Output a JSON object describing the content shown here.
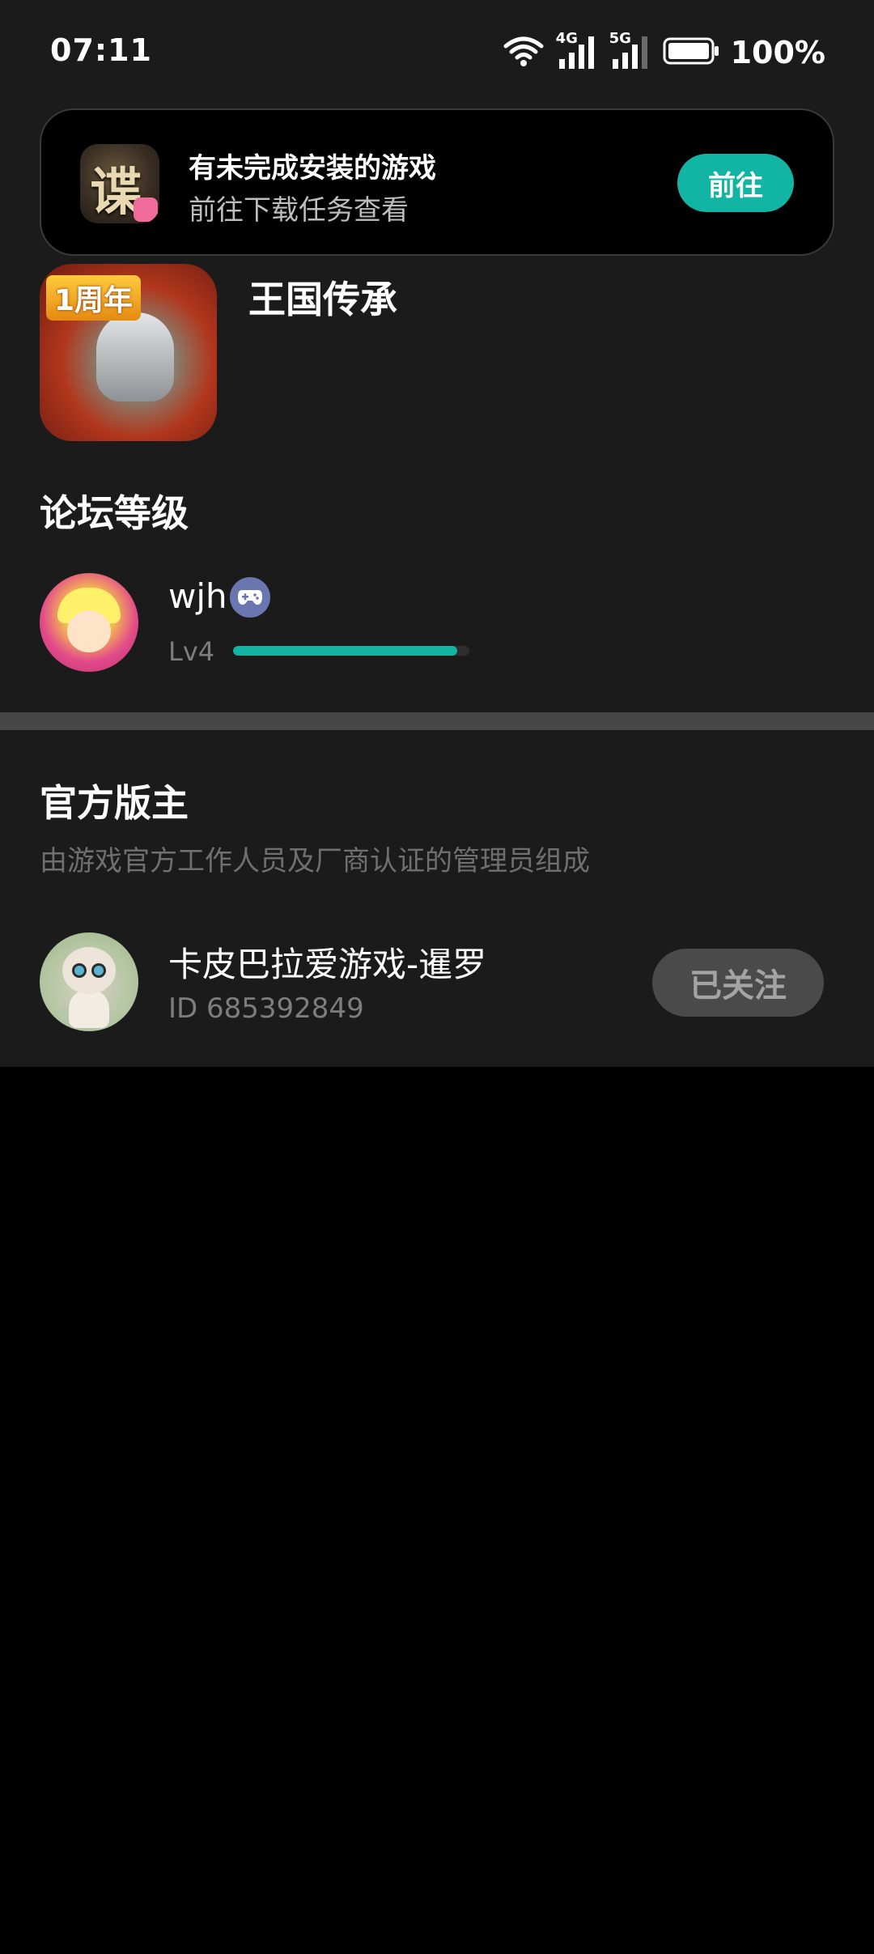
{
  "status_bar": {
    "time": "07:11",
    "network_1": "4G",
    "network_2": "5G",
    "battery_percent": "100%"
  },
  "banner": {
    "title": "有未完成安装的游戏",
    "subtitle": "前往下载任务查看",
    "button_label": "前往",
    "icon_glyph": "谍"
  },
  "game": {
    "title": "王国传承",
    "icon_badge": "1周年"
  },
  "forum_level": {
    "section_title": "论坛等级",
    "username": "wjh",
    "level_label": "Lv4",
    "level_progress": 0.95
  },
  "official_moderators": {
    "section_title": "官方版主",
    "section_desc": "由游戏官方工作人员及厂商认证的管理员组成",
    "moderators": [
      {
        "name": "卡皮巴拉爱游戏-暹罗",
        "id_text": "ID 685392849",
        "follow_label": "已关注"
      }
    ]
  },
  "colors": {
    "accent": "#12b5a4",
    "panel_bg": "#1b1b1b",
    "page_bg": "#000000",
    "divider": "#474747"
  },
  "icons": {
    "status": [
      "wifi-icon",
      "signal-4g-icon",
      "signal-5g-icon",
      "battery-icon"
    ],
    "user_badge": "gamepad-icon"
  }
}
